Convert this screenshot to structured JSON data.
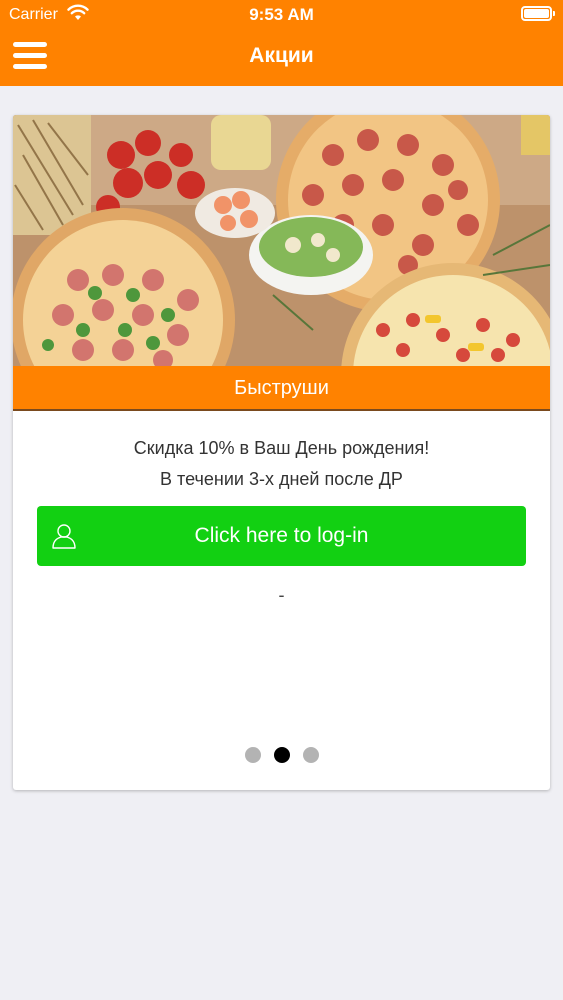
{
  "status_bar": {
    "carrier": "Carrier",
    "time": "9:53 AM"
  },
  "nav": {
    "title": "Акции",
    "menu_icon": "hamburger-menu-icon"
  },
  "promo": {
    "image_description_icon": "pizza-photo",
    "banner_title": "Быструши",
    "description_line1": "Скидка 10% в Ваш День рождения!",
    "description_line2": "В течении 3-х дней после ДР",
    "login_button_label": "Click here to log-in",
    "login_icon": "user-icon",
    "note": "-"
  },
  "pager": {
    "pages": 3,
    "active_index": 1
  },
  "colors": {
    "accent": "#ff8200",
    "login_button": "#12d012",
    "background": "#efeff4"
  }
}
